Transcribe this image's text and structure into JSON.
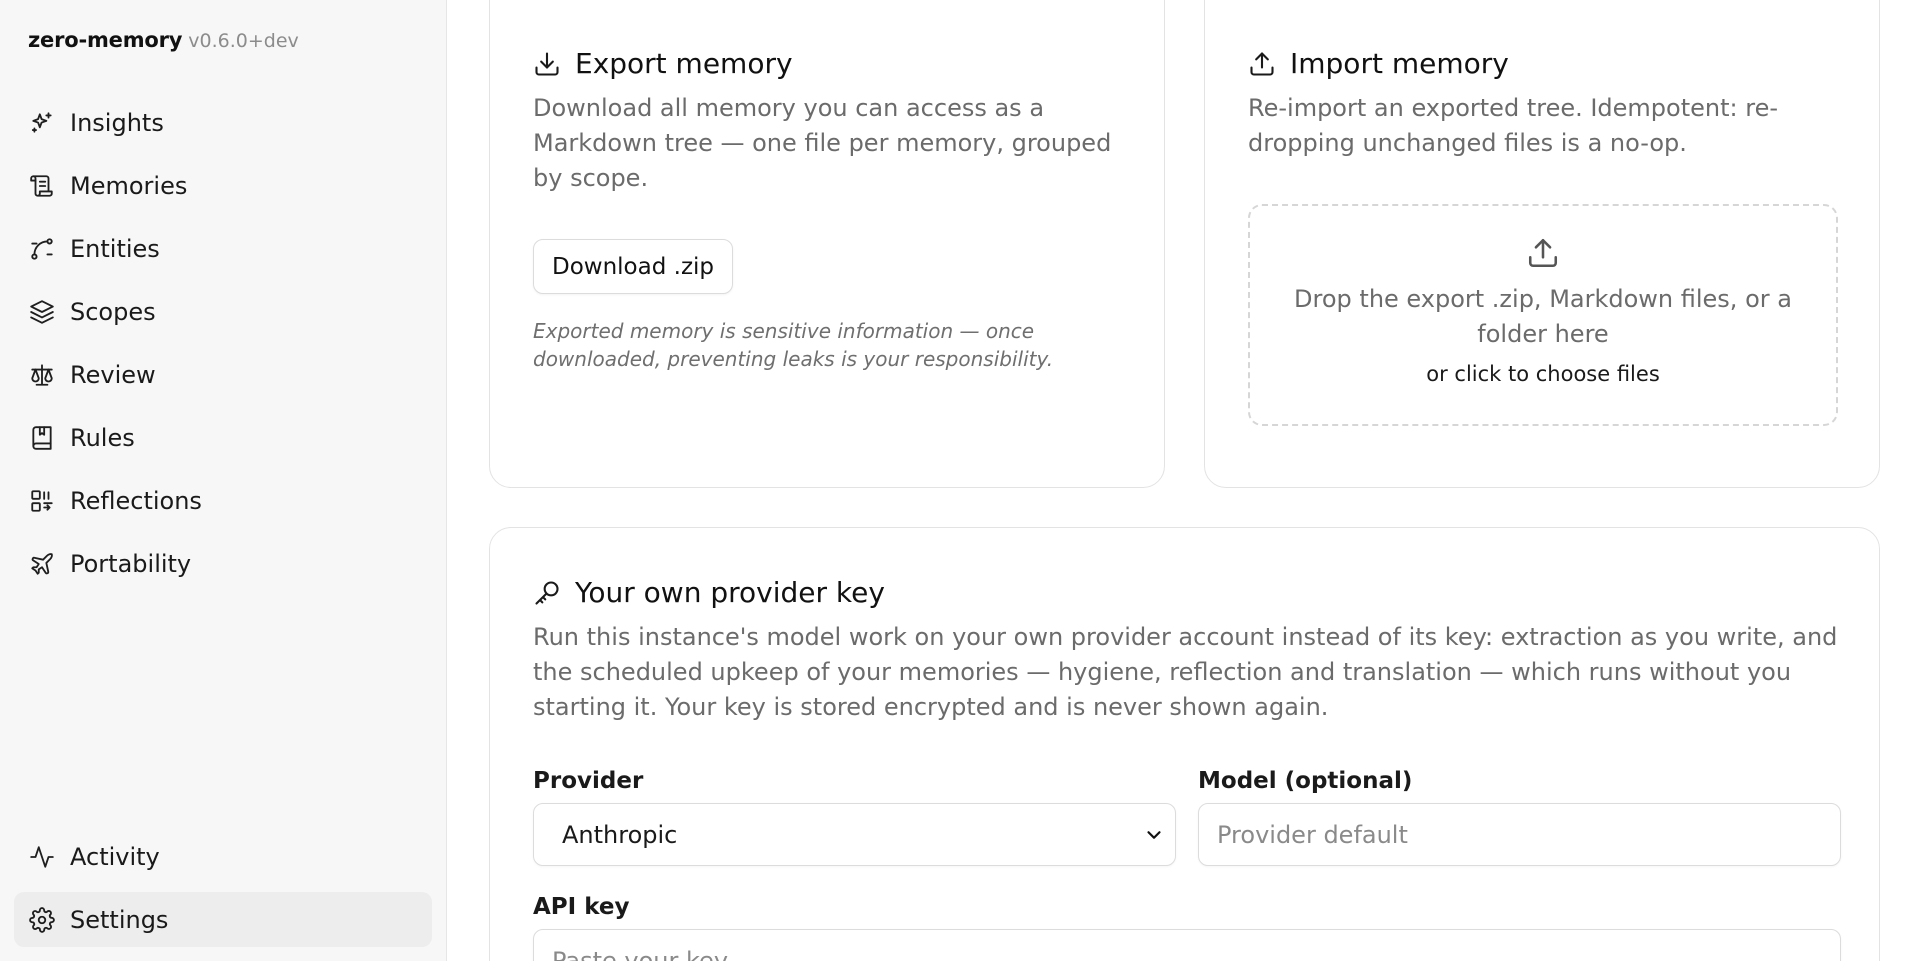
{
  "app": {
    "name": "zero-memory",
    "version": "v0.6.0+dev"
  },
  "sidebar": {
    "items": [
      {
        "label": "Insights",
        "icon": "sparkles-icon"
      },
      {
        "label": "Memories",
        "icon": "scroll-icon"
      },
      {
        "label": "Entities",
        "icon": "spline-icon"
      },
      {
        "label": "Scopes",
        "icon": "layers-icon"
      },
      {
        "label": "Review",
        "icon": "scale-icon"
      },
      {
        "label": "Rules",
        "icon": "book-marked-icon"
      },
      {
        "label": "Reflections",
        "icon": "reflection-icon"
      },
      {
        "label": "Portability",
        "icon": "plane-icon"
      }
    ],
    "bottom_items": [
      {
        "label": "Activity",
        "icon": "activity-icon"
      },
      {
        "label": "Settings",
        "icon": "gear-icon",
        "active": true
      }
    ]
  },
  "export": {
    "title": "Export memory",
    "description": "Download all memory you can access as a Markdown tree — one file per memory, grouped by scope.",
    "button_label": "Download .zip",
    "note": "Exported memory is sensitive information — once downloaded, preventing leaks is your responsibility."
  },
  "import": {
    "title": "Import memory",
    "description": "Re-import an exported tree. Idempotent: re-dropping unchanged files is a no-op.",
    "dropzone_text": "Drop the export .zip, Markdown files, or a folder here",
    "dropzone_subtext": "or click to choose files"
  },
  "provider_key": {
    "title": "Your own provider key",
    "description": "Run this instance's model work on your own provider account instead of its key: extraction as you write, and the scheduled upkeep of your memories — hygiene, reflection and translation — which runs without you starting it. Your key is stored encrypted and is never shown again.",
    "provider_label": "Provider",
    "provider_value": "Anthropic",
    "model_label": "Model (optional)",
    "model_placeholder": "Provider default",
    "apikey_label": "API key",
    "apikey_placeholder": "Paste your key"
  }
}
